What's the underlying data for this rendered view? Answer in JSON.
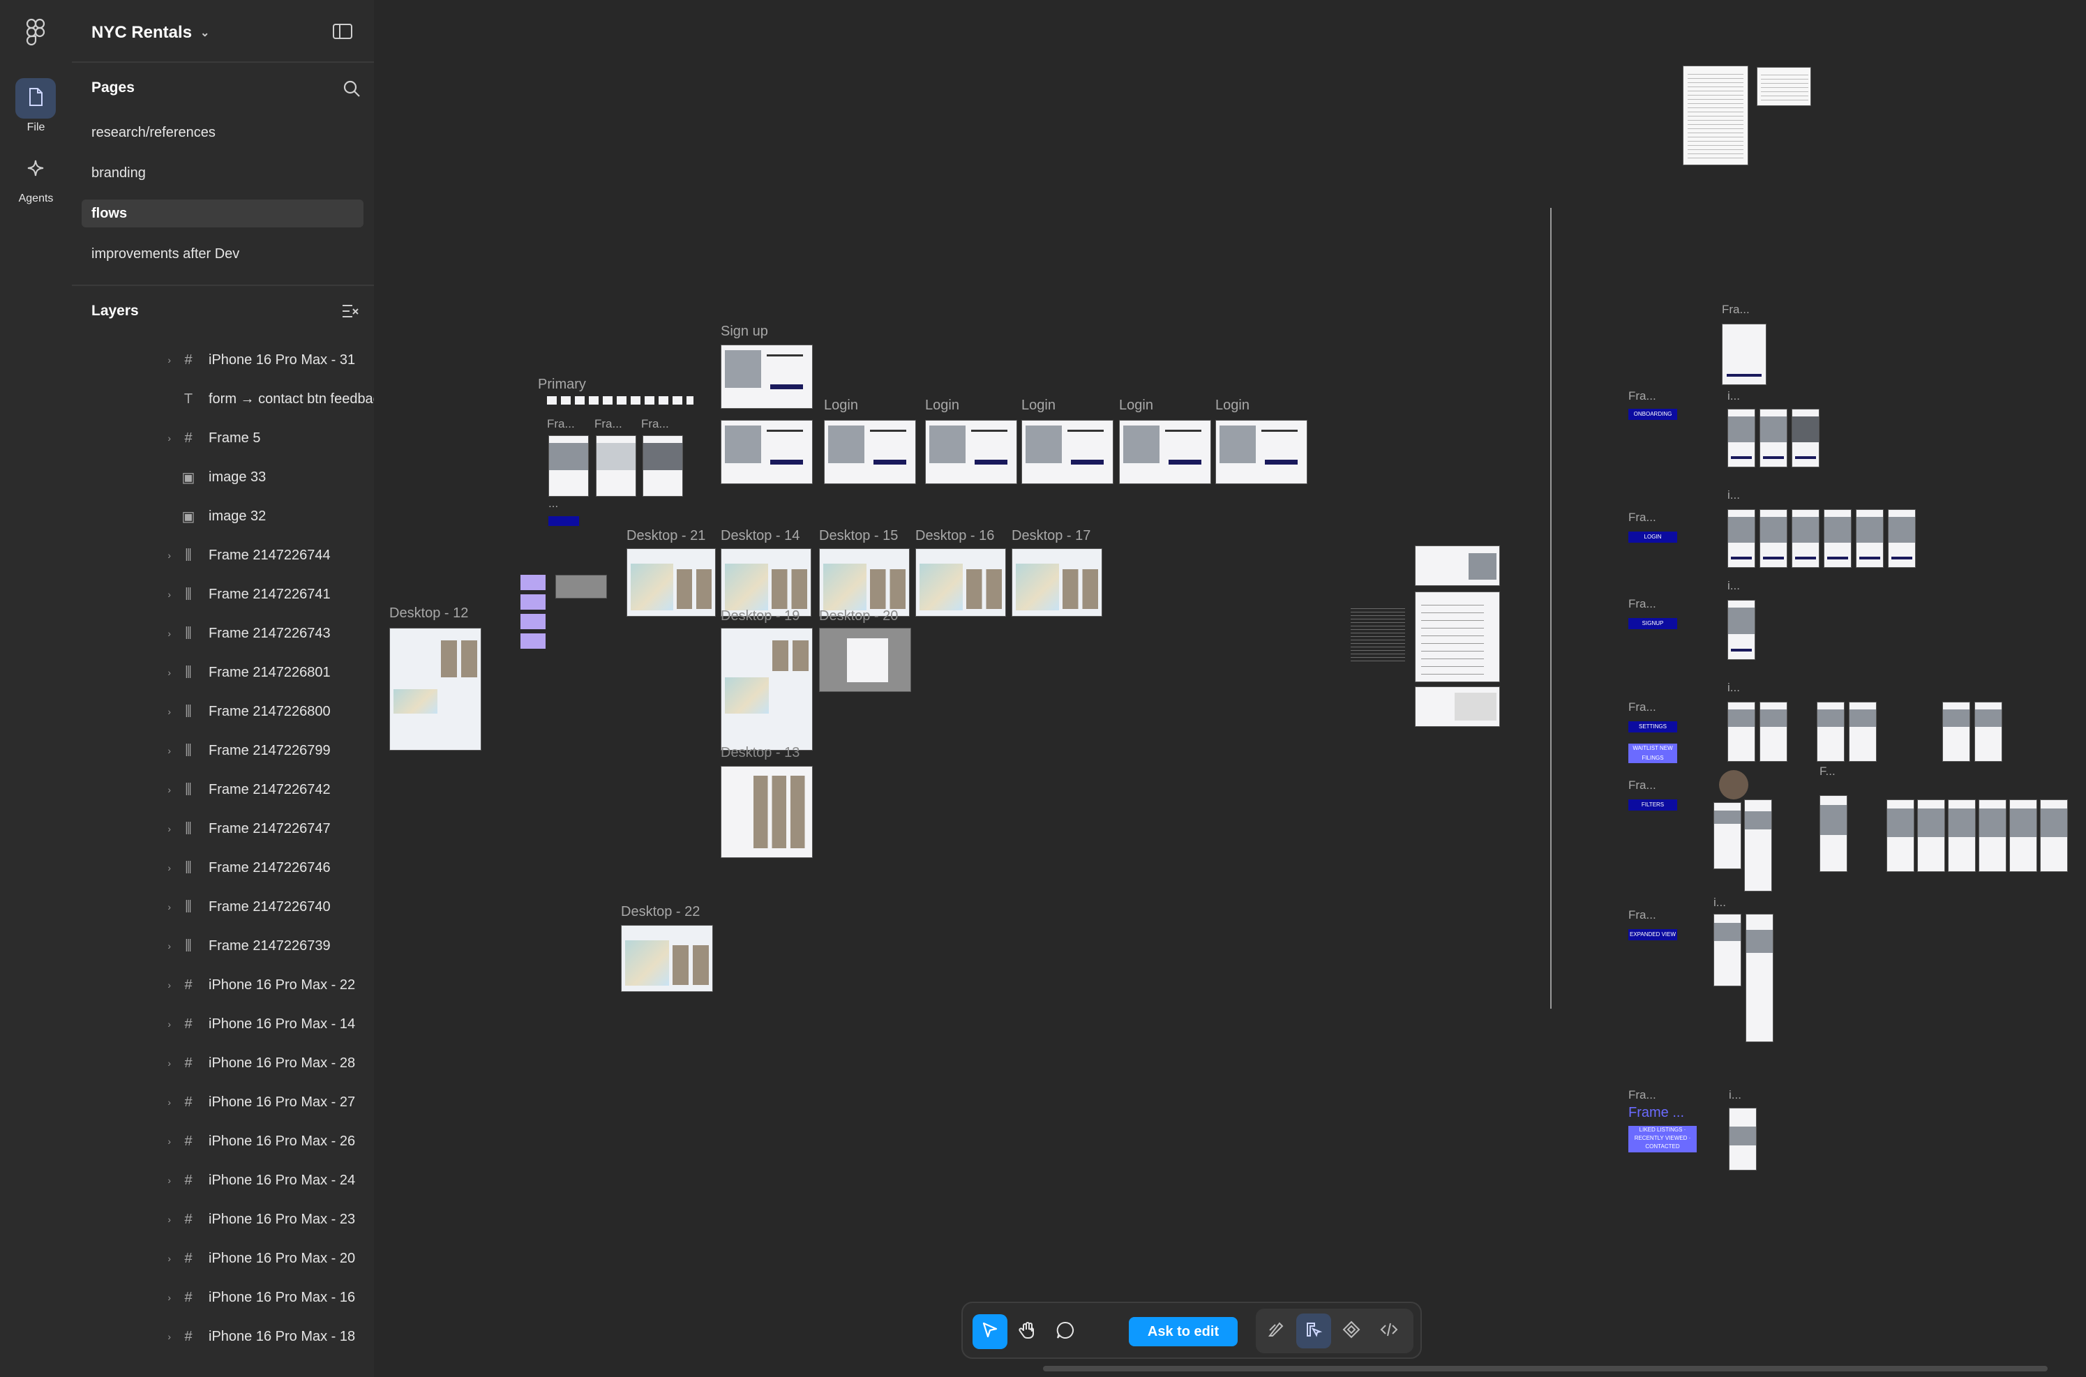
{
  "rail": {
    "items": [
      {
        "label": "File",
        "icon": "file-icon"
      },
      {
        "label": "Agents",
        "icon": "sparkle-icon"
      }
    ]
  },
  "panel": {
    "file_name": "NYC Rentals",
    "pages_title": "Pages",
    "pages": [
      "research/references",
      "branding",
      "flows",
      "improvements after Dev"
    ],
    "selected_page": "flows",
    "layers_title": "Layers",
    "layers": [
      {
        "name": "iPhone 16 Pro Max - 31",
        "icon": "frame-icon",
        "expandable": true
      },
      {
        "name": "form → contact btn feedback - we w",
        "icon": "text-icon",
        "expandable": false
      },
      {
        "name": "Frame 5",
        "icon": "frame-icon",
        "expandable": true
      },
      {
        "name": "image 33",
        "icon": "image-icon",
        "expandable": false
      },
      {
        "name": "image 32",
        "icon": "image-icon",
        "expandable": false
      },
      {
        "name": "Frame 2147226744",
        "icon": "auto-layout-icon",
        "expandable": true
      },
      {
        "name": "Frame 2147226741",
        "icon": "auto-layout-icon",
        "expandable": true
      },
      {
        "name": "Frame 2147226743",
        "icon": "auto-layout-icon",
        "expandable": true
      },
      {
        "name": "Frame 2147226801",
        "icon": "auto-layout-icon",
        "expandable": true
      },
      {
        "name": "Frame 2147226800",
        "icon": "auto-layout-icon",
        "expandable": true
      },
      {
        "name": "Frame 2147226799",
        "icon": "auto-layout-icon",
        "expandable": true
      },
      {
        "name": "Frame 2147226742",
        "icon": "auto-layout-icon",
        "expandable": true
      },
      {
        "name": "Frame 2147226747",
        "icon": "auto-layout-icon",
        "expandable": true
      },
      {
        "name": "Frame 2147226746",
        "icon": "auto-layout-icon",
        "expandable": true
      },
      {
        "name": "Frame 2147226740",
        "icon": "auto-layout-icon",
        "expandable": true
      },
      {
        "name": "Frame 2147226739",
        "icon": "auto-layout-icon",
        "expandable": true
      },
      {
        "name": "iPhone 16 Pro Max - 22",
        "icon": "frame-icon",
        "expandable": true
      },
      {
        "name": "iPhone 16 Pro Max - 14",
        "icon": "frame-icon",
        "expandable": true
      },
      {
        "name": "iPhone 16 Pro Max - 28",
        "icon": "frame-icon",
        "expandable": true
      },
      {
        "name": "iPhone 16 Pro Max - 27",
        "icon": "frame-icon",
        "expandable": true
      },
      {
        "name": "iPhone 16 Pro Max - 26",
        "icon": "frame-icon",
        "expandable": true
      },
      {
        "name": "iPhone 16 Pro Max - 24",
        "icon": "frame-icon",
        "expandable": true
      },
      {
        "name": "iPhone 16 Pro Max - 23",
        "icon": "frame-icon",
        "expandable": true
      },
      {
        "name": "iPhone 16 Pro Max - 20",
        "icon": "frame-icon",
        "expandable": true
      },
      {
        "name": "iPhone 16 Pro Max - 16",
        "icon": "frame-icon",
        "expandable": true
      },
      {
        "name": "iPhone 16 Pro Max - 18",
        "icon": "frame-icon",
        "expandable": true
      }
    ]
  },
  "canvas": {
    "labels": {
      "signup": "Sign up",
      "primary": "Primary",
      "fra": "Fra...",
      "login": "Login",
      "desktop_21": "Desktop - 21",
      "desktop_14": "Desktop - 14",
      "desktop_15": "Desktop - 15",
      "desktop_16": "Desktop - 16",
      "desktop_17": "Desktop - 17",
      "desktop_12": "Desktop - 12",
      "desktop_19": "Desktop - 19",
      "desktop_20": "Desktop - 20",
      "desktop_13": "Desktop - 13",
      "desktop_22": "Desktop - 22",
      "frame_ellipsis": "Frame ...",
      "i_ellipsis": "i...",
      "f_ellipsis": "F...",
      "dots": "..."
    },
    "tags": {
      "onboarding": "ONBOARDING",
      "login": "LOGIN",
      "signup": "SIGNUP",
      "settings": "SETTINGS",
      "waitlist": "WAITLIST NEW FILINGS",
      "filters": "FILTERS",
      "expanded": "EXPANDED VIEW",
      "liked": "LIKED LISTINGS · RECENTLY VIEWED · CONTACTED"
    }
  },
  "toolbar": {
    "tools": [
      "move-icon",
      "hand-icon",
      "comment-icon"
    ],
    "ask_label": "Ask to edit",
    "modes": [
      "draw-icon",
      "design-icon",
      "dev-component-icon",
      "code-icon"
    ],
    "accent": "#0d99ff"
  }
}
